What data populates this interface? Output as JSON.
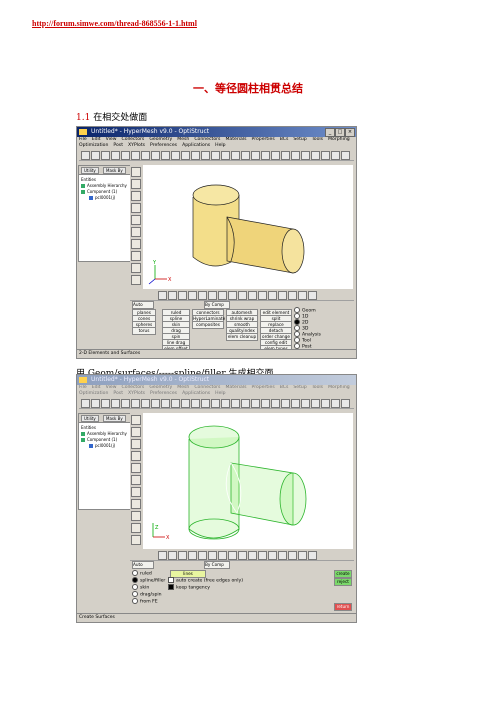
{
  "doc": {
    "url": "http://forum.simwe.com/thread-868556-1-1.html",
    "heading": "一、等径圆柱相贯总结",
    "section_num": "1.1",
    "section_text": "在相交处做面",
    "caption": "用 Geom/surfaces/-----spline/filler 生成相交面"
  },
  "app": {
    "title": "Untitled* - HyperMesh v9.0 - OptiStruct",
    "menu1": [
      "File",
      "Edit",
      "View",
      "Collectors",
      "Geometry",
      "Mesh",
      "Connectors",
      "Materials",
      "Properties",
      "BCs",
      "Setup",
      "Tools",
      "Morphing"
    ],
    "menu2": [
      "Optimization",
      "Post",
      "XYPlots",
      "Preferences",
      "Applications",
      "Help"
    ],
    "left_tabs": [
      "Utility",
      "Mask By"
    ],
    "tree_header": "Entities",
    "tree": [
      "Assembly Hierarchy",
      "Component (1)",
      "pcl0001(j)"
    ],
    "axis_x": "X",
    "axis_y": "Y",
    "axis_z": "Z"
  },
  "panel1": {
    "auto": "Auto",
    "by_comp": "By Comp",
    "col1": [
      "planes",
      "cones",
      "spheres",
      "torus"
    ],
    "col2": [
      "ruled",
      "spline",
      "skin",
      "drag",
      "spin",
      "line drag",
      "elem offset"
    ],
    "col3": [
      "connectors",
      "HyperLaminate",
      "composites"
    ],
    "col4": [
      "automesh",
      "shrink wrap",
      "smooth",
      "qualityindex",
      "elem cleanup"
    ],
    "col5": [
      "edit element",
      "split",
      "replace",
      "detach",
      "order change",
      "config edit",
      "elem types"
    ],
    "radios": [
      "Geom",
      "1D",
      "2D",
      "3D",
      "Analysis",
      "Tool",
      "Post"
    ],
    "radio_selected": "2D",
    "status": "2-D Elements and Surfaces"
  },
  "panel2": {
    "auto": "Auto",
    "by_comp": "By Comp",
    "options": [
      "ruled",
      "spline/filler",
      "skin",
      "drag/spin",
      "from FE"
    ],
    "selected": "spline/filler",
    "field_label": "lines",
    "check1": "auto create (free edges only)",
    "check2": "keep tangency",
    "btn_create": "create",
    "btn_reject": "reject",
    "btn_return": "return",
    "status": "Create Surfaces"
  }
}
